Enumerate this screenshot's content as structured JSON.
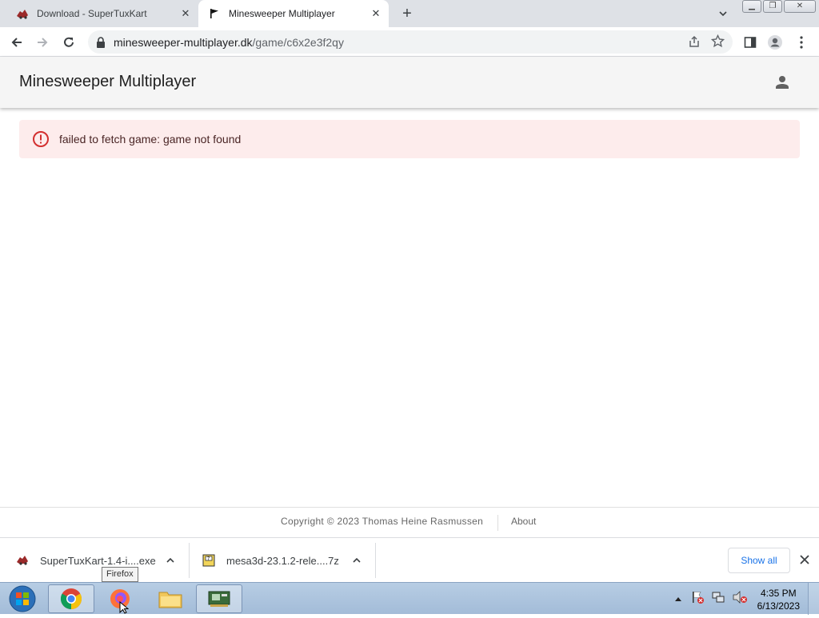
{
  "browser": {
    "tabs": [
      {
        "title": "Download - SuperTuxKart",
        "active": false
      },
      {
        "title": "Minesweeper Multiplayer",
        "active": true
      }
    ],
    "url_host": "minesweeper-multiplayer.dk",
    "url_path": "/game/c6x2e3f2qy"
  },
  "app": {
    "title": "Minesweeper Multiplayer",
    "error_message": "failed to fetch game: game not found"
  },
  "footer": {
    "copyright": "Copyright © 2023 Thomas Heine Rasmussen",
    "about": "About"
  },
  "downloads": {
    "items": [
      {
        "name": "SuperTuxKart-1.4-i....exe"
      },
      {
        "name": "mesa3d-23.1.2-rele....7z"
      }
    ],
    "show_all": "Show all"
  },
  "tooltip": "Firefox",
  "taskbar": {
    "time": "4:35 PM",
    "date": "6/13/2023"
  },
  "colors": {
    "error_bg": "#fdecec",
    "error_icon": "#d32f2f",
    "link_blue": "#1a73e8"
  }
}
